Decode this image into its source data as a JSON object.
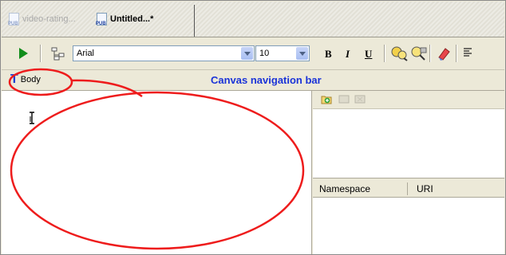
{
  "tabs": [
    {
      "label": "video-rating...",
      "active": false
    },
    {
      "label": "Untitled...*",
      "active": true
    }
  ],
  "toolbar": {
    "font_value": "Arial",
    "size_value": "10",
    "bold": "B",
    "italic": "I",
    "underline": "U"
  },
  "nav": {
    "body_label": "Body",
    "caption": "Canvas navigation bar"
  },
  "namespace_table": {
    "columns": [
      "Namespace",
      "URI"
    ]
  },
  "icons": [
    "pub-document-icon",
    "play-icon",
    "schema-tree-icon",
    "find-icon",
    "zoom-icon",
    "eraser-icon",
    "align-left-icon",
    "add-namespace-icon",
    "text-cursor-icon"
  ],
  "colors": {
    "annotation_red": "#ee1c1c",
    "caption_blue": "#1a33d8",
    "play_green": "#118d1b"
  }
}
